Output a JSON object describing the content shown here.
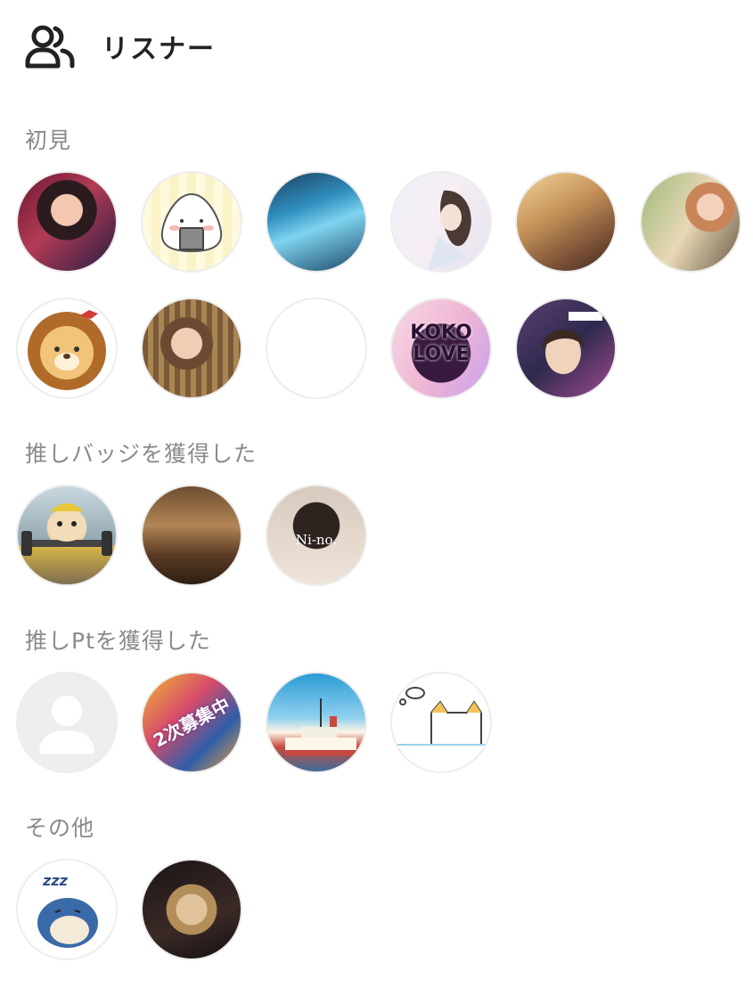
{
  "header": {
    "title": "リスナー",
    "icon": "users-icon"
  },
  "sections": [
    {
      "title": "初見",
      "avatars": [
        {
          "name": "avatar-girl-red-hair"
        },
        {
          "name": "avatar-onigiri"
        },
        {
          "name": "avatar-blue-character"
        },
        {
          "name": "avatar-illustrated-woman"
        },
        {
          "name": "avatar-blonde-woman"
        },
        {
          "name": "avatar-woman-flowers"
        },
        {
          "name": "avatar-lion"
        },
        {
          "name": "avatar-woman-hair-flower"
        },
        {
          "name": "avatar-blank"
        },
        {
          "name": "avatar-koko-love",
          "text": "KOKO\nLOVE"
        },
        {
          "name": "avatar-collage-woman"
        }
      ]
    },
    {
      "title": "推しバッジを獲得した",
      "avatars": [
        {
          "name": "avatar-hamster"
        },
        {
          "name": "avatar-horse-race"
        },
        {
          "name": "avatar-ni-no",
          "text": "Ni-no."
        }
      ]
    },
    {
      "title": "推しPtを獲得した",
      "avatars": [
        {
          "name": "avatar-default"
        },
        {
          "name": "avatar-recruiting",
          "text": "2次募集中"
        },
        {
          "name": "avatar-ship"
        },
        {
          "name": "avatar-cat"
        }
      ]
    },
    {
      "title": "その他",
      "avatars": [
        {
          "name": "avatar-sleeping-snorlax",
          "text": "zzz"
        },
        {
          "name": "avatar-dark-woman"
        }
      ]
    }
  ],
  "colors": {
    "section_title": "#8a8a8a",
    "header_text": "#222222",
    "avatar_border": "#ededed"
  }
}
